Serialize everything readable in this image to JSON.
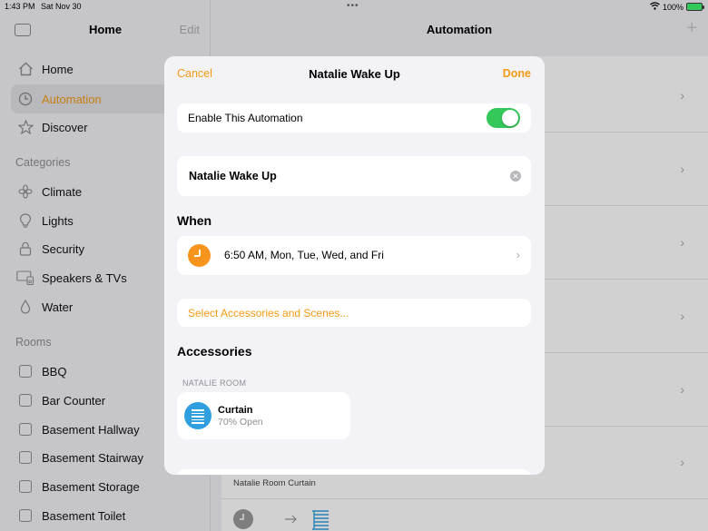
{
  "status_bar": {
    "time": "1:43 PM",
    "date": "Sat Nov 30",
    "battery": "100%"
  },
  "sidebar": {
    "title": "Home",
    "edit_label": "Edit",
    "items": [
      {
        "label": "Home",
        "icon": "house-icon"
      },
      {
        "label": "Automation",
        "icon": "clock-icon",
        "active": true
      },
      {
        "label": "Discover",
        "icon": "star-icon"
      }
    ],
    "categories_header": "Categories",
    "categories": [
      {
        "label": "Climate",
        "icon": "fan-icon"
      },
      {
        "label": "Lights",
        "icon": "lightbulb-icon"
      },
      {
        "label": "Security",
        "icon": "lock-icon"
      },
      {
        "label": "Speakers & TVs",
        "icon": "speaker-tv-icon"
      },
      {
        "label": "Water",
        "icon": "drop-icon"
      }
    ],
    "rooms_header": "Rooms",
    "rooms": [
      "BBQ",
      "Bar Counter",
      "Basement Hallway",
      "Basement Stairway",
      "Basement Storage",
      "Basement Toilet"
    ]
  },
  "main": {
    "title": "Automation",
    "add_icon": "plus-icon",
    "background_caption": "Natalie Room Curtain"
  },
  "modal": {
    "cancel_label": "Cancel",
    "title": "Natalie Wake Up",
    "done_label": "Done",
    "enable_label": "Enable This Automation",
    "enabled": true,
    "name_value": "Natalie Wake Up",
    "when_heading": "When",
    "when_text": "6:50 AM, Mon, Tue, Wed, and Fri",
    "select_label": "Select Accessories and Scenes...",
    "accessories_heading": "Accessories",
    "room_label": "NATALIE ROOM",
    "accessory": {
      "name": "Curtain",
      "state": "70% Open"
    }
  },
  "colors": {
    "accent": "#f29b13",
    "toggle_on": "#34c759",
    "curtain_icon": "#2f9fe0",
    "clock_icon": "#f7941d"
  }
}
